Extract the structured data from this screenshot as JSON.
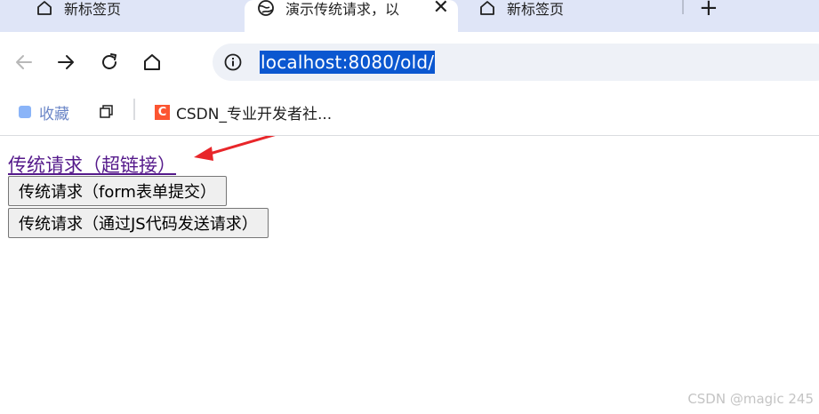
{
  "tabs": [
    {
      "title": "新标签页",
      "icon": "home-icon",
      "active": false
    },
    {
      "title": "演示传统请求，以",
      "icon": "globe-icon",
      "active": true,
      "close": "✕"
    },
    {
      "title": "新标签页",
      "icon": "home-icon",
      "active": false
    }
  ],
  "new_tab_label": "+",
  "omnibox": {
    "url": "localhost:8080/old/"
  },
  "bookmarks": {
    "favorites_label": "收藏",
    "csdn_label": "CSDN_专业开发者社...",
    "csdn_logo_letter": "C"
  },
  "page": {
    "link_text": "传统请求（超链接）",
    "button_form": "传统请求（form表单提交）",
    "button_js": "传统请求（通过JS代码发送请求）"
  },
  "watermark": "CSDN @magic 245",
  "colors": {
    "tabstrip": "#dfe5f7",
    "url_highlight": "#0b57d0",
    "link_visited": "#551a8b",
    "annotation_arrow": "#e8262a",
    "csdn_brand": "#fc5531"
  }
}
